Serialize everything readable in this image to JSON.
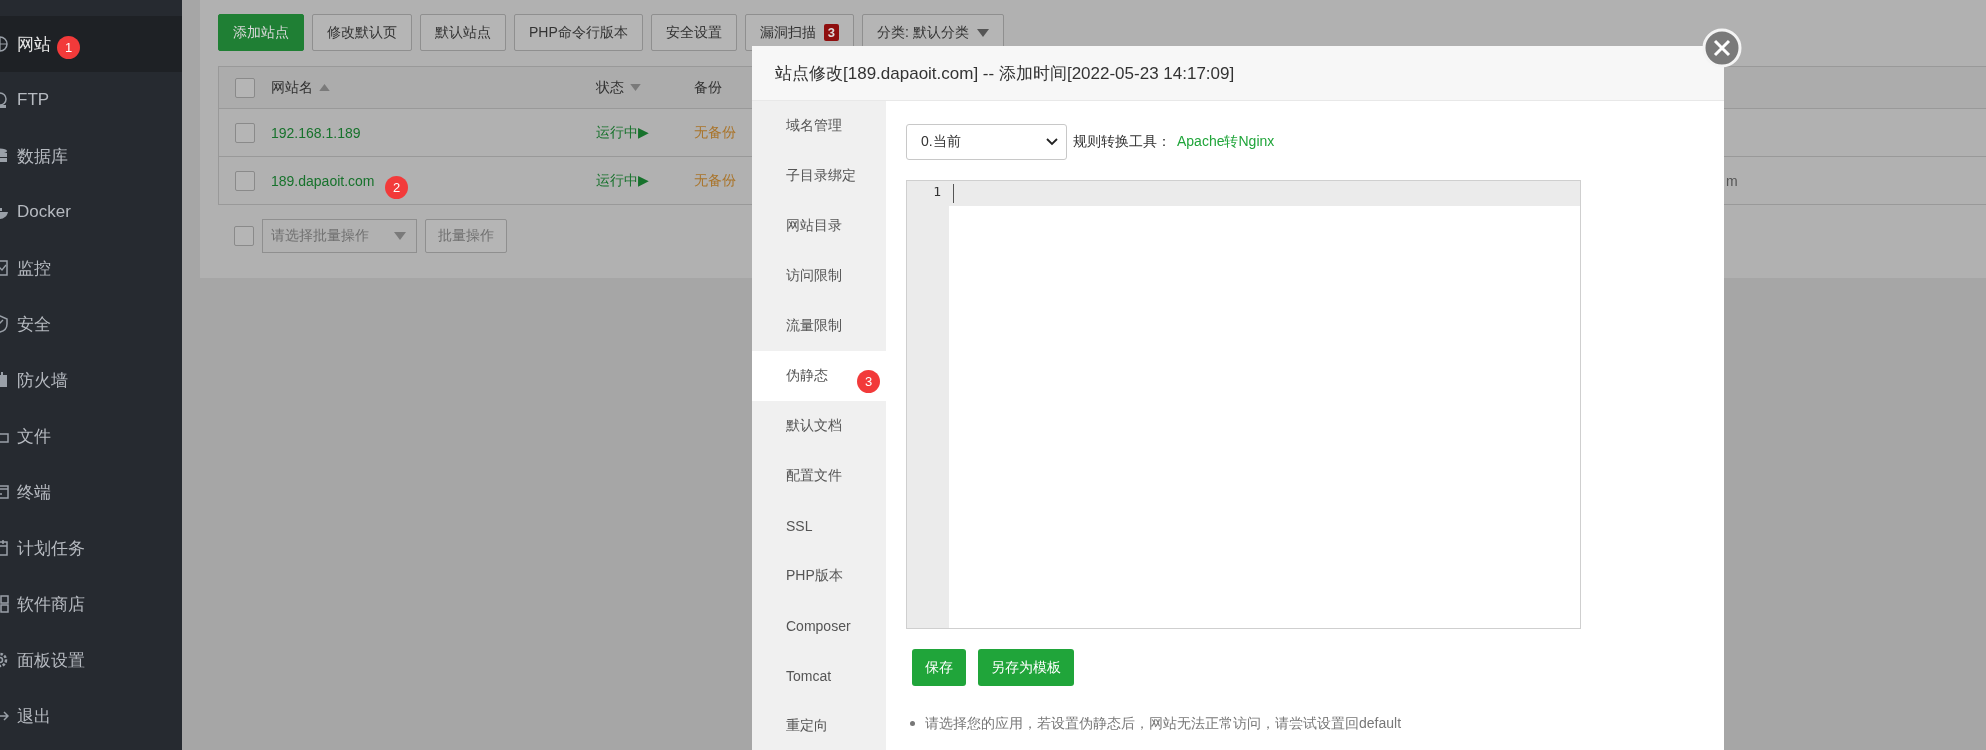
{
  "sidebar": {
    "items": [
      {
        "label": "网站",
        "selected": true,
        "marker": "1"
      },
      {
        "label": "FTP",
        "selected": false
      },
      {
        "label": "数据库",
        "selected": false
      },
      {
        "label": "Docker",
        "selected": false
      },
      {
        "label": "监控",
        "selected": false
      },
      {
        "label": "安全",
        "selected": false
      },
      {
        "label": "防火墙",
        "selected": false
      },
      {
        "label": "文件",
        "selected": false
      },
      {
        "label": "终端",
        "selected": false
      },
      {
        "label": "计划任务",
        "selected": false
      },
      {
        "label": "软件商店",
        "selected": false
      },
      {
        "label": "面板设置",
        "selected": false
      },
      {
        "label": "退出",
        "selected": false
      }
    ]
  },
  "toolbar": {
    "buttons": [
      {
        "label": "添加站点",
        "kind": "primary"
      },
      {
        "label": "修改默认页",
        "kind": "default"
      },
      {
        "label": "默认站点",
        "kind": "default"
      },
      {
        "label": "PHP命令行版本",
        "kind": "default"
      },
      {
        "label": "安全设置",
        "kind": "default"
      },
      {
        "label": "漏洞扫描",
        "kind": "default",
        "badge": "3"
      }
    ],
    "category": "分类: 默认分类"
  },
  "table": {
    "all_checked": false,
    "columns": [
      {
        "label": "网站名",
        "sortable": true,
        "ascending": true
      },
      {
        "label": "状态",
        "sortable": true,
        "ascending": false
      },
      {
        "label": "备份"
      }
    ],
    "rows": [
      {
        "checked": false,
        "name": "192.168.1.189",
        "status": "运行中▶",
        "backup": "无备份"
      },
      {
        "checked": false,
        "name": "189.dapaoit.com",
        "status": "运行中▶",
        "backup": "无备份",
        "column_4": "m",
        "marker": "2"
      }
    ]
  },
  "batch": {
    "checked": false,
    "placeholder": "请选择批量操作",
    "button": "批量操作"
  },
  "modal": {
    "title": "站点修改[189.dapaoit.com] -- 添加时间[2022-05-23 14:17:09]",
    "nav": [
      {
        "label": "域名管理",
        "selected": false
      },
      {
        "label": "子目录绑定",
        "selected": false
      },
      {
        "label": "网站目录",
        "selected": false
      },
      {
        "label": "访问限制",
        "selected": false
      },
      {
        "label": "流量限制",
        "selected": false
      },
      {
        "label": "伪静态",
        "selected": true,
        "marker": "3"
      },
      {
        "label": "默认文档",
        "selected": false
      },
      {
        "label": "配置文件",
        "selected": false
      },
      {
        "label": "SSL",
        "selected": false
      },
      {
        "label": "PHP版本",
        "selected": false
      },
      {
        "label": "Composer",
        "selected": false
      },
      {
        "label": "Tomcat",
        "selected": false
      },
      {
        "label": "重定向",
        "selected": false
      }
    ],
    "select_value": "0.当前",
    "tool_label": "规则转换工具：",
    "tool_link": "Apache转Nginx",
    "editor": {
      "line_numbers": [
        "1"
      ]
    },
    "buttons": [
      "保存",
      "另存为模板"
    ],
    "notes": [
      "请选择您的应用，若设置伪静态后，网站无法正常访问，请尝试设置回default"
    ]
  }
}
